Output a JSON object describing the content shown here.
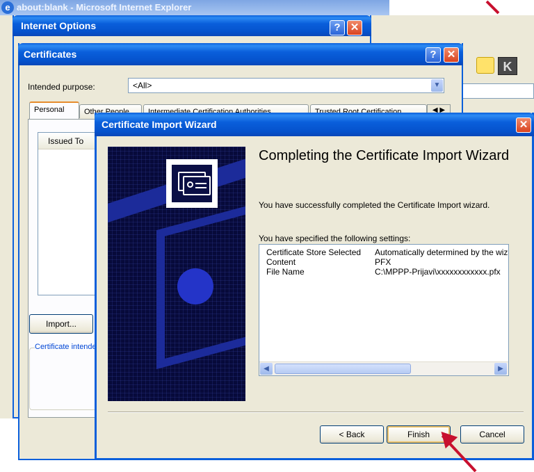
{
  "ie": {
    "title": "about:blank - Microsoft Internet Explorer"
  },
  "internet_options": {
    "title": "Internet Options",
    "help": "?",
    "close": "✕"
  },
  "certificates": {
    "title": "Certificates",
    "help": "?",
    "close": "✕",
    "purpose_label": "Intended purpose:",
    "purpose_value": "<All>",
    "tabs": [
      "Personal",
      "Other People",
      "Intermediate Certification Authorities",
      "Trusted Root Certification"
    ],
    "column": "Issued To",
    "import_label": "Import...",
    "group_label": "Certificate intended purposes"
  },
  "wizard": {
    "title": "Certificate Import Wizard",
    "close": "✕",
    "heading": "Completing the Certificate Import Wizard",
    "success_text": "You have successfully completed the Certificate Import wizard.",
    "settings_label": "You have specified the following settings:",
    "settings": [
      {
        "name": "Certificate Store Selected",
        "value": "Automatically determined by the wizard"
      },
      {
        "name": "Content",
        "value": "PFX"
      },
      {
        "name": "File Name",
        "value": "C:\\MPPP-Prijavi\\xxxxxxxxxxxx.pfx"
      }
    ],
    "back_label": "< Back",
    "finish_label": "Finish",
    "cancel_label": "Cancel"
  },
  "colors": {
    "xp_blue": "#0a5fdb",
    "dialog_face": "#ece9d8",
    "arrow": "#c8102e"
  }
}
